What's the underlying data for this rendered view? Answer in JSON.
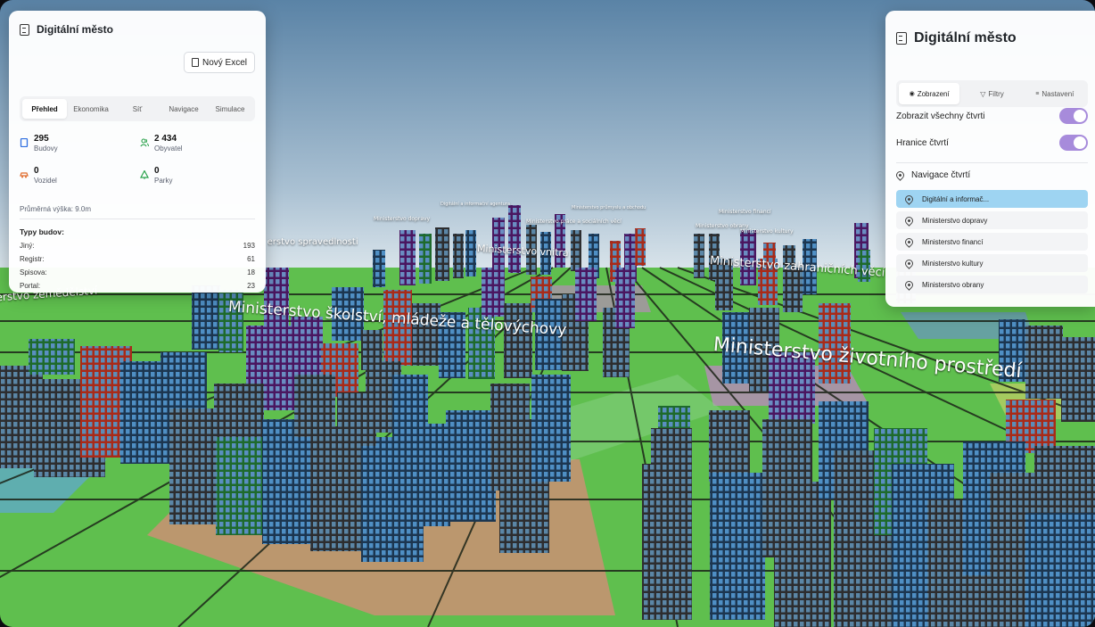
{
  "left_panel": {
    "title": "Digitální město",
    "excel_button": "Nový Excel",
    "tabs": [
      "Přehled",
      "Ekonomika",
      "Síť",
      "Navigace",
      "Simulace"
    ],
    "active_tab": "Přehled",
    "stats": {
      "buildings": {
        "value": "295",
        "label": "Budovy"
      },
      "residents": {
        "value": "2 434",
        "label": "Obyvatel"
      },
      "vehicles": {
        "value": "0",
        "label": "Vozidel"
      },
      "parks": {
        "value": "0",
        "label": "Parky"
      }
    },
    "avg_height": "Průměrná výška: 9.0m",
    "types_title": "Typy budov:",
    "types": [
      {
        "name": "Jiný:",
        "count": "193"
      },
      {
        "name": "Registr:",
        "count": "61"
      },
      {
        "name": "Spisova:",
        "count": "18"
      },
      {
        "name": "Portal:",
        "count": "23"
      }
    ]
  },
  "right_panel": {
    "title": "Digitální město",
    "tabs": [
      {
        "label": "Zobrazení",
        "icon": "eye-icon"
      },
      {
        "label": "Filtry",
        "icon": "filter-icon"
      },
      {
        "label": "Nastavení",
        "icon": "sliders-icon"
      }
    ],
    "active_tab": "Zobrazení",
    "toggles": [
      {
        "label": "Zobrazit všechny čtvrti",
        "on": true
      },
      {
        "label": "Hranice čtvrtí",
        "on": true
      }
    ],
    "nav_title": "Navigace čtvrtí",
    "nav_items": [
      {
        "label": "Digitální a informač...",
        "selected": true
      },
      {
        "label": "Ministerstvo dopravy",
        "selected": false
      },
      {
        "label": "Ministerstvo financí",
        "selected": false
      },
      {
        "label": "Ministerstvo kultury",
        "selected": false
      },
      {
        "label": "Ministerstvo obrany",
        "selected": false
      }
    ]
  },
  "scene": {
    "labels": {
      "skolstvi": "Ministerstvo školství, mládeže a tělovýchovy",
      "zivotni": "Ministerstvo životního prostředí",
      "vnitra": "Ministerstvo vnitra",
      "zahranicni": "Ministerstvo zahraničních věcí",
      "spravedlnost": "Ministerstvo spravedlnosti",
      "zemedelstvi": "Ministerstvo zemědělství",
      "small_1": "Digitální a informační agentura",
      "small_2": "Ministerstvo dopravy",
      "small_3": "Ministerstvo financí",
      "small_4": "Ministerstvo průmyslu a obchodu",
      "small_5": "Ministerstvo práce a sociálních věcí",
      "small_6": "Ministerstvo obrany",
      "small_7": "Ministerstvo kultury"
    }
  },
  "colors": {
    "grass": "#5fbf4e",
    "grid": "#1f2a1a",
    "sky_top": "#5f86a8",
    "sky_bottom": "#c9d8e2",
    "toggle_on": "#a78bdb",
    "nav_selected": "#9ed4f2"
  }
}
